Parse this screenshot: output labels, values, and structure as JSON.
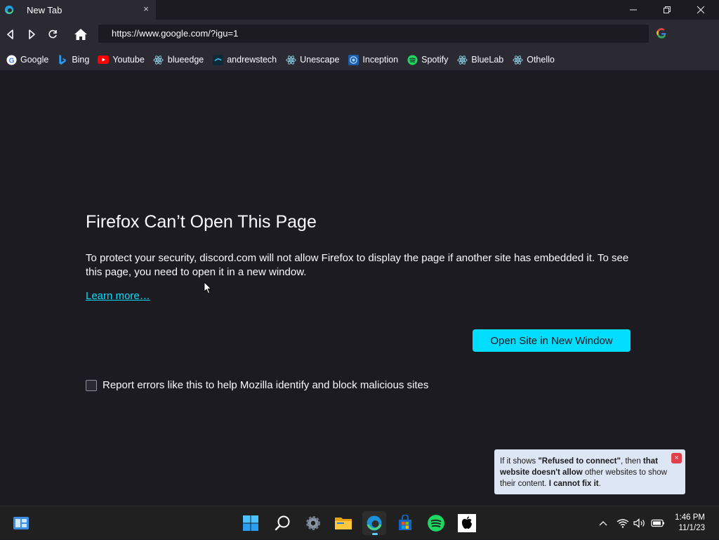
{
  "tab": {
    "title": "New Tab",
    "close": "×"
  },
  "window_controls": {
    "minimize": "—",
    "maximize": "❐",
    "close": "✕"
  },
  "navbar": {
    "url": "https://www.google.com/?igu=1",
    "back_icon": "back-arrow-icon",
    "forward_icon": "forward-arrow-icon",
    "reload_icon": "reload-icon",
    "home_icon": "home-icon"
  },
  "bookmarks": [
    {
      "label": "Google",
      "icon": "google-icon"
    },
    {
      "label": "Bing",
      "icon": "bing-icon"
    },
    {
      "label": "Youtube",
      "icon": "youtube-icon"
    },
    {
      "label": "blueedge",
      "icon": "react-icon"
    },
    {
      "label": "andrewstech",
      "icon": "andrewstech-icon"
    },
    {
      "label": "Unescape",
      "icon": "react-icon"
    },
    {
      "label": "Inception",
      "icon": "inception-icon"
    },
    {
      "label": "Spotify",
      "icon": "spotify-icon"
    },
    {
      "label": "BlueLab",
      "icon": "react-icon"
    },
    {
      "label": "Othello",
      "icon": "react-icon"
    }
  ],
  "error": {
    "title": "Firefox Can’t Open This Page",
    "description": "To protect your security, discord.com will not allow Firefox to display the page if another site has embedded it. To see this page, you need to open it in a new window.",
    "learn_more": "Learn more…",
    "open_button": "Open Site in New Window",
    "report_label": "Report errors like this to help Mozilla identify and block malicious sites"
  },
  "toast": {
    "p1": "If it shows ",
    "b1": "\"Refused to connect\"",
    "p2": ", then ",
    "b2": "that website doesn't allow",
    "p3": " other websites to show their content. ",
    "b3": "I cannot fix it",
    "p4": ".",
    "close": "×"
  },
  "taskbar": {
    "time": "1:46 PM",
    "date": "11/1/23"
  },
  "colors": {
    "accent": "#00ddff",
    "page_bg": "#1c1b22",
    "toolbar_bg": "#2b2a33",
    "toast_bg": "#dce6f5",
    "toast_close": "#e0404a"
  }
}
